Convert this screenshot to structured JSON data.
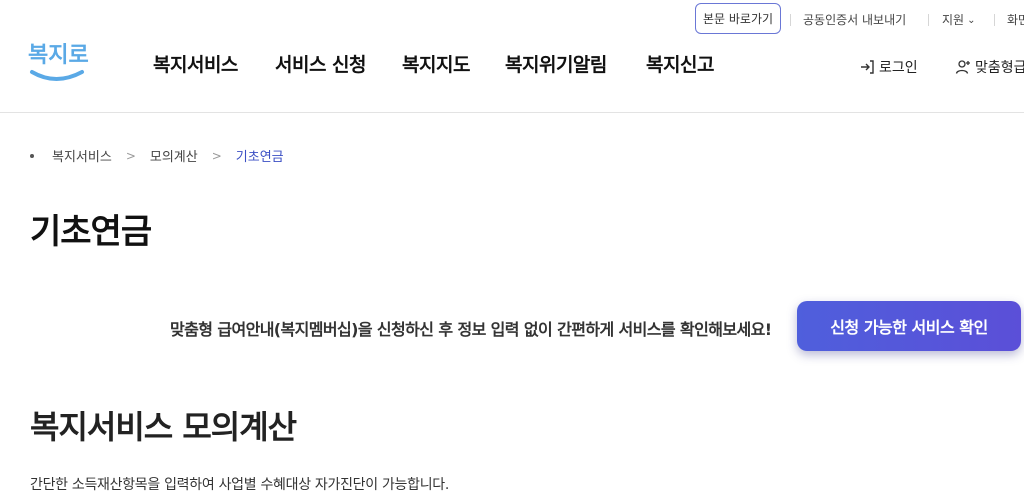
{
  "utility": {
    "skip_link": "본문 바로가기",
    "certificate": "공동인증서 내보내기",
    "support": "지원",
    "truncated_item": "화면"
  },
  "header": {
    "logo_text": "복지로",
    "nav": [
      "복지서비스",
      "서비스 신청",
      "복지지도",
      "복지위기알림",
      "복지신고"
    ],
    "login": "로그인",
    "signup": "맞춤형급"
  },
  "breadcrumb": [
    "복지서비스",
    "모의계산",
    "기초연금"
  ],
  "page_title": "기초연금",
  "promo": {
    "text": "맞춤형 급여안내(복지멤버십)을 신청하신 후 정보 입력 없이 간편하게 서비스를 확인해보세요!",
    "button": "신청 가능한 서비스 확인"
  },
  "section": {
    "title": "복지서비스 모의계산",
    "description": "간단한 소득재산항목을 입력하여 사업별 수혜대상 자가진단이 가능합니다."
  },
  "colors": {
    "accent": "#4f5fdc",
    "logo_blue": "#5aa9e6",
    "breadcrumb_current": "#3b4fc4"
  }
}
